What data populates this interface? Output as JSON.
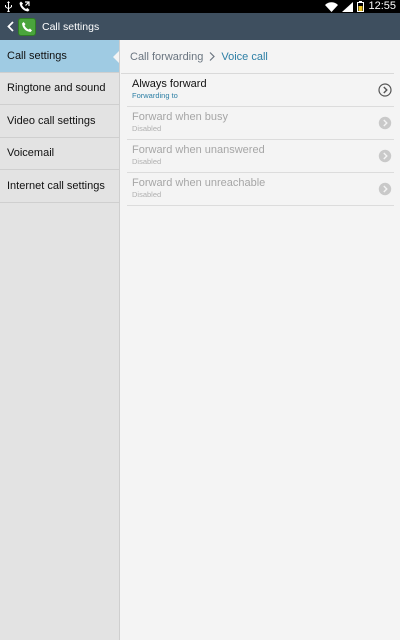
{
  "status_bar": {
    "time": "12:55",
    "icons": [
      "usb-icon",
      "call-icon",
      "wifi-icon",
      "signal-icon",
      "battery-icon"
    ]
  },
  "action_bar": {
    "title": "Call settings",
    "back_icon": "chevron-left-icon",
    "app_icon": "phone-icon",
    "app_icon_color": "#4aa53c",
    "background": "#3e4f5f"
  },
  "sidebar": {
    "items": [
      {
        "label": "Call settings",
        "active": true
      },
      {
        "label": "Ringtone and sound",
        "active": false
      },
      {
        "label": "Video call settings",
        "active": false
      },
      {
        "label": "Voicemail",
        "active": false
      },
      {
        "label": "Internet call settings",
        "active": false
      }
    ],
    "active_color": "#9fcbe3"
  },
  "breadcrumb": {
    "parent": "Call forwarding",
    "current": "Voice call"
  },
  "settings": [
    {
      "title": "Always forward",
      "subtitle": "Forwarding to",
      "enabled": true
    },
    {
      "title": "Forward when busy",
      "subtitle": "Disabled",
      "enabled": false
    },
    {
      "title": "Forward when unanswered",
      "subtitle": "Disabled",
      "enabled": false
    },
    {
      "title": "Forward when unreachable",
      "subtitle": "Disabled",
      "enabled": false
    }
  ],
  "colors": {
    "accent": "#2d7fa5"
  }
}
